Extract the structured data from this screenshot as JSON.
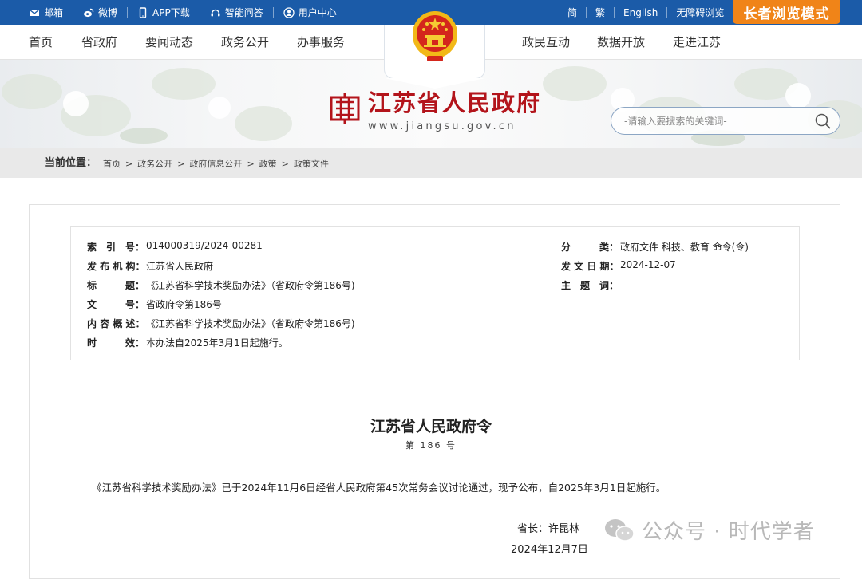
{
  "topbar": {
    "left_items": [
      {
        "label": "邮箱",
        "icon": "mail-icon"
      },
      {
        "label": "微博",
        "icon": "weibo-icon"
      },
      {
        "label": "APP下载",
        "icon": "phone-icon"
      },
      {
        "label": "智能问答",
        "icon": "headset-icon"
      },
      {
        "label": "用户中心",
        "icon": "user-icon"
      }
    ],
    "right_items": [
      "简",
      "繁",
      "English",
      "无障碍浏览"
    ],
    "elder_mode": "长者浏览模式"
  },
  "nav": {
    "left": [
      "首页",
      "省政府",
      "要闻动态",
      "政务公开",
      "办事服务"
    ],
    "right": [
      "政民互动",
      "数据开放",
      "走进江苏"
    ]
  },
  "logo": {
    "title": "江苏省人民政府",
    "url": "www.jiangsu.gov.cn"
  },
  "search": {
    "placeholder": "-请输入要搜索的关键词-"
  },
  "breadcrumb": {
    "label": "当前位置：",
    "items": [
      "首页",
      "政务公开",
      "政府信息公开",
      "政策",
      "政策文件"
    ]
  },
  "meta": {
    "index_label": "索　引　号：",
    "index_value": "014000319/2024-00281",
    "publisher_label": "发 布 机 构：",
    "publisher_value": "江苏省人民政府",
    "title_label": "标　　　题：",
    "title_value": "《江苏省科学技术奖励办法》（省政府令第186号)",
    "docno_label": "文　　　号：",
    "docno_value": "省政府令第186号",
    "summary_label": "内 容 概 述：",
    "summary_value": "《江苏省科学技术奖励办法》（省政府令第186号)",
    "effect_label": "时　　　效：",
    "effect_value": "本办法自2025年3月1日起施行。",
    "category_label": "分　　　类：",
    "category_value": "政府文件 科技、教育 命令(令)",
    "date_label": "发 文 日 期：",
    "date_value": "2024-12-07",
    "subject_label": "主　题　词：",
    "subject_value": ""
  },
  "doc": {
    "title": "江苏省人民政府令",
    "number": "第 186 号",
    "paragraph": "《江苏省科学技术奖励办法》已于2024年11月6日经省人民政府第45次常务会议讨论通过，现予公布，自2025年3月1日起施行。",
    "signer": "省长：许昆林",
    "sign_date": "2024年12月7日"
  },
  "watermark": "公众号 · 时代学者",
  "colors": {
    "topbar": "#1b5ba8",
    "elder": "#f08418",
    "logo_red": "#b3141b"
  }
}
